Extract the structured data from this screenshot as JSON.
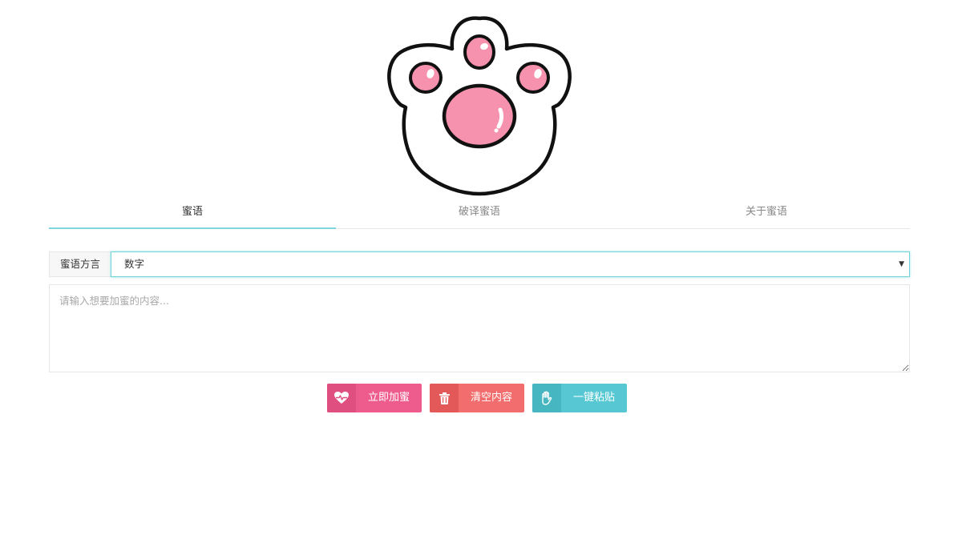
{
  "logo": {
    "icon": "cat-paw-icon",
    "colors": {
      "pad": "#f692ad",
      "outline": "#111111",
      "fill": "#ffffff"
    }
  },
  "tabs": [
    {
      "label": "蜜语",
      "active": true
    },
    {
      "label": "破译蜜语",
      "active": false
    },
    {
      "label": "关于蜜语",
      "active": false
    }
  ],
  "dialect": {
    "label": "蜜语方言",
    "selected": "数字"
  },
  "content": {
    "placeholder": "请输入想要加蜜的内容...",
    "value": ""
  },
  "buttons": {
    "encrypt": {
      "label": "立即加蜜",
      "icon": "heart-pulse-icon",
      "color": "#ee5c8d"
    },
    "clear": {
      "label": "清空内容",
      "icon": "trash-icon",
      "color": "#f26d6d"
    },
    "paste": {
      "label": "一键粘贴",
      "icon": "hand-icon",
      "color": "#57c8d3"
    }
  },
  "theme": {
    "accent": "#7fd6dc"
  }
}
